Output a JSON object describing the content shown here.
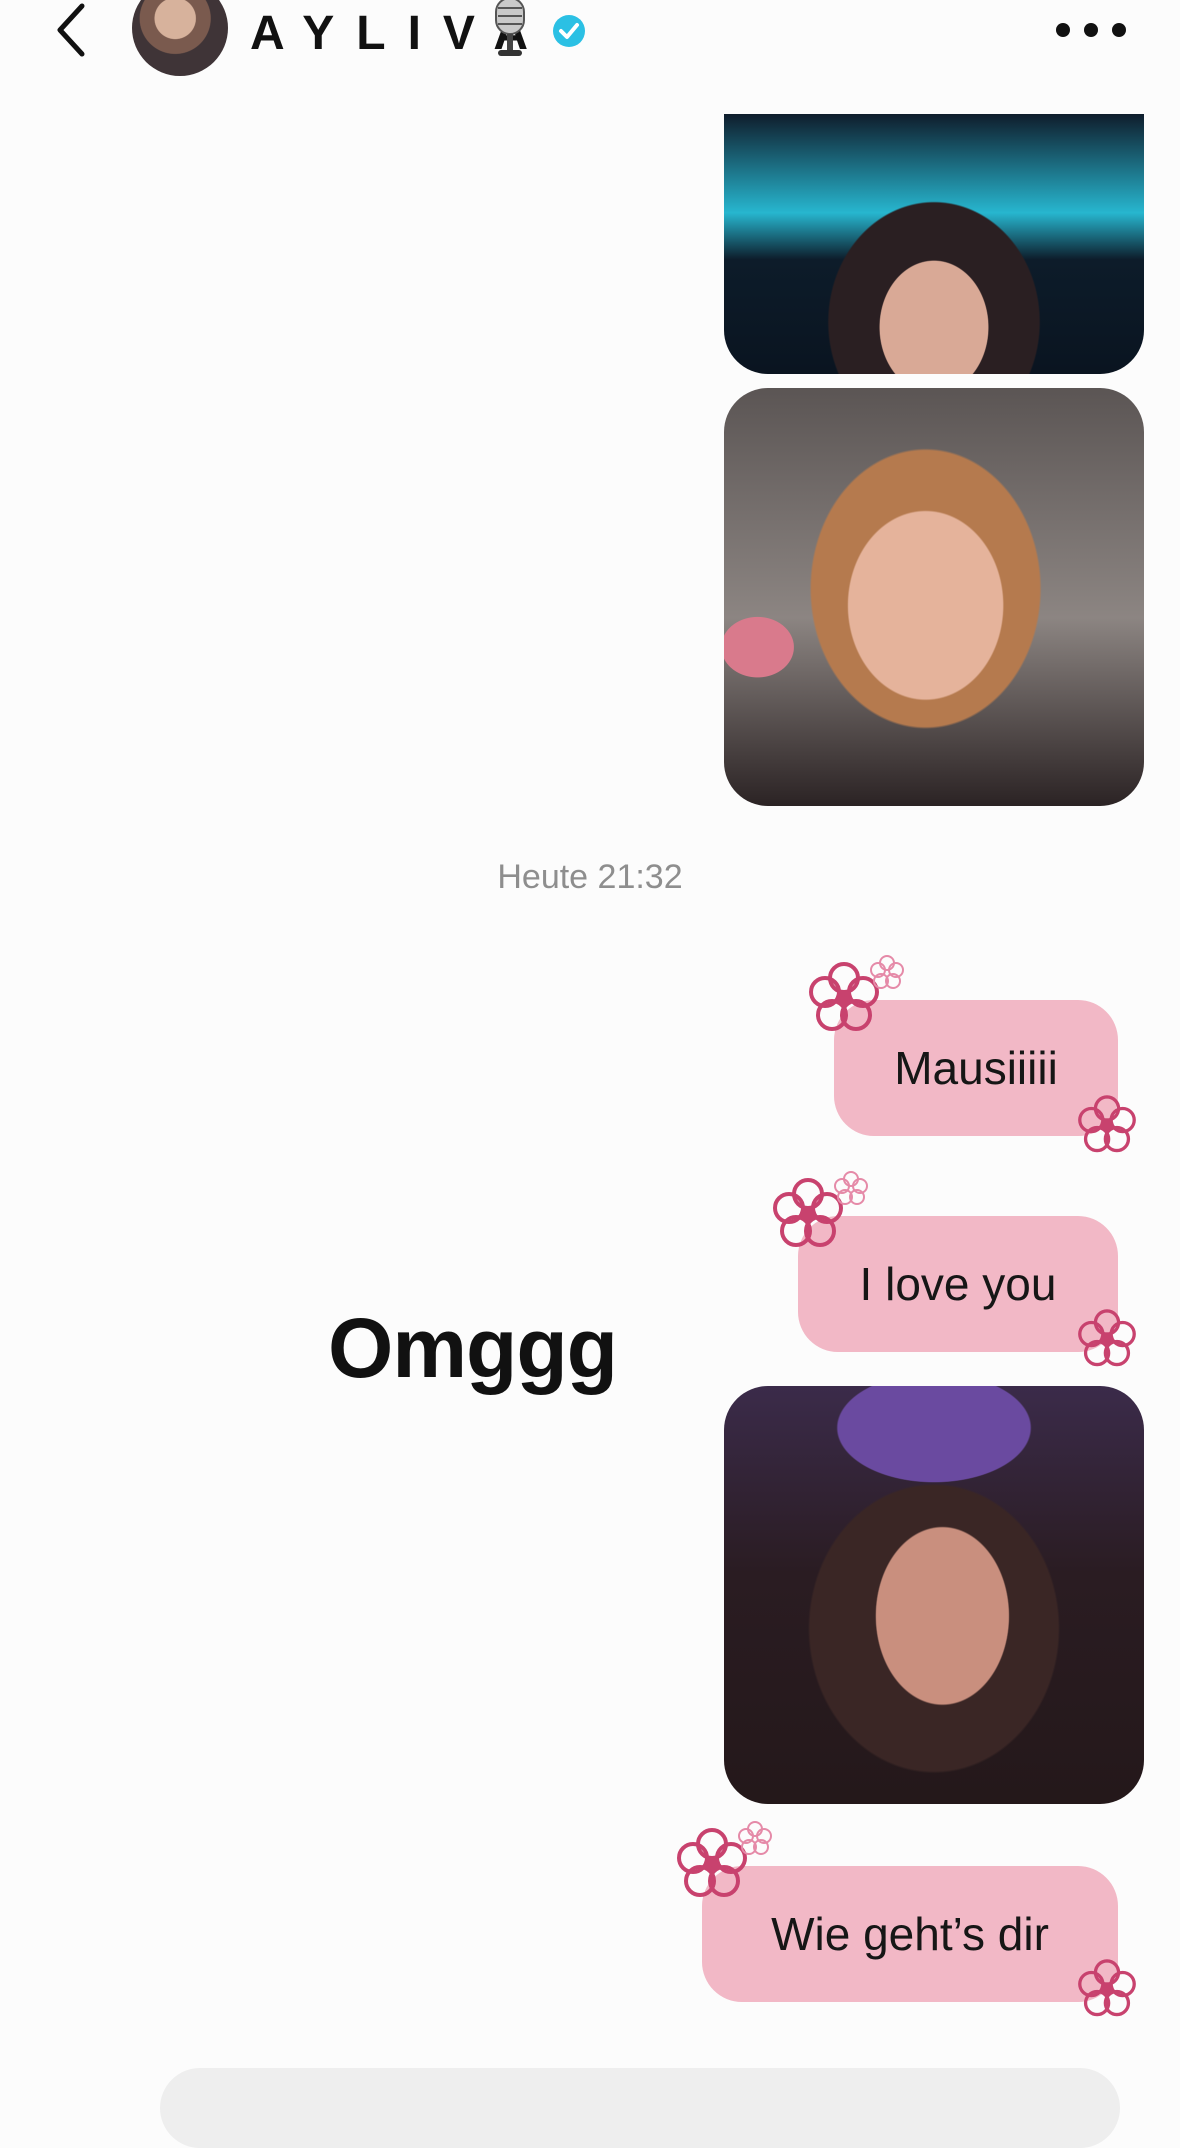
{
  "header": {
    "contact_name": "AYLIVA",
    "icons": {
      "back": "chevron-left-icon",
      "mic": "microphone-emoji-icon",
      "verified": "verified-badge-icon",
      "more": "more-horizontal-icon"
    },
    "verified_color": "#2bc0e4"
  },
  "conversation": {
    "timestamp": "Heute 21:32",
    "messages": [
      {
        "type": "image",
        "description": "video-frame"
      },
      {
        "type": "image",
        "description": "video-frame"
      },
      {
        "type": "text",
        "text": "Mausiiiii"
      },
      {
        "type": "text",
        "text": "I love you"
      },
      {
        "type": "image",
        "description": "video-frame"
      },
      {
        "type": "text",
        "text": "Wie geht’s dir"
      }
    ],
    "reaction_text": "Omggg"
  },
  "colors": {
    "bubble": "#f2b8c6",
    "flower": "#c8426e",
    "background": "#fcfcfc"
  }
}
